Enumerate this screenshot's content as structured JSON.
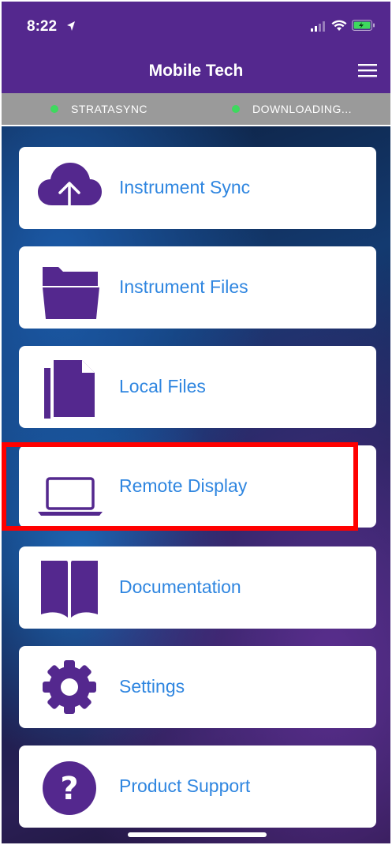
{
  "status_bar": {
    "time": "8:22",
    "location_icon": "location-arrow-icon",
    "signal_icon": "cellular-signal-icon",
    "wifi_icon": "wifi-icon",
    "battery_icon": "battery-charging-icon"
  },
  "header": {
    "title": "Mobile Tech",
    "menu_icon": "hamburger-menu-icon"
  },
  "sync_bar": {
    "left_label": "STRATASYNC",
    "right_label": "DOWNLOADING...",
    "dot_color": "#3ed95e"
  },
  "menu": {
    "items": [
      {
        "label": "Instrument Sync",
        "icon": "cloud-upload-icon"
      },
      {
        "label": "Instrument Files",
        "icon": "folder-icon"
      },
      {
        "label": "Local Files",
        "icon": "files-icon"
      },
      {
        "label": "Remote Display",
        "icon": "laptop-icon"
      },
      {
        "label": "Documentation",
        "icon": "book-icon"
      },
      {
        "label": "Settings",
        "icon": "gear-icon"
      },
      {
        "label": "Product Support",
        "icon": "question-icon"
      }
    ]
  },
  "colors": {
    "header": "#54288e",
    "icon": "#54288e",
    "label": "#2f86e0",
    "sync_bar": "#9a9a9a",
    "highlight": "#ff0000"
  }
}
